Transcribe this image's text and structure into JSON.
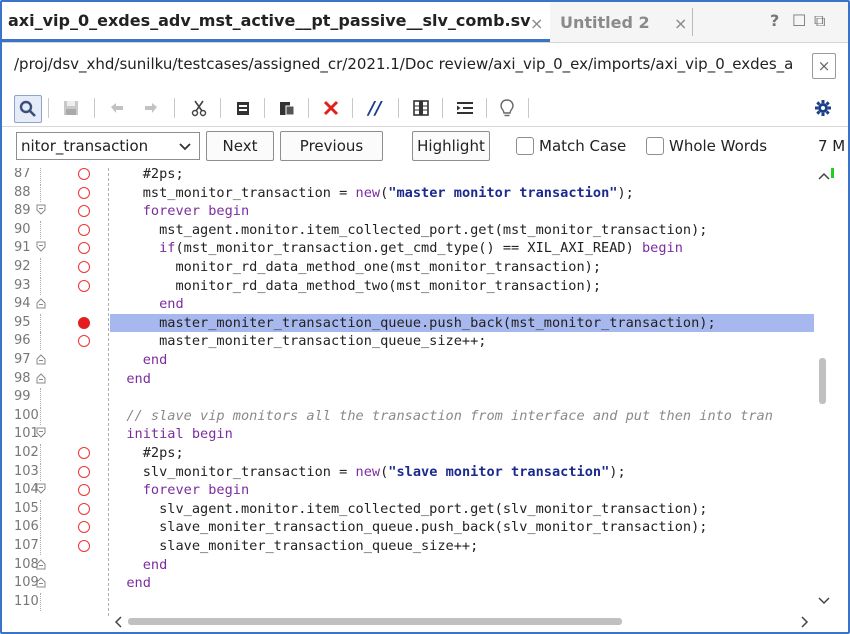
{
  "tabs": [
    {
      "label": "axi_vip_0_exdes_adv_mst_active__pt_passive__slv_comb.sv",
      "active": true
    },
    {
      "label": "Untitled 2",
      "active": false
    }
  ],
  "window_controls": {
    "help": "?",
    "restore": "☐",
    "float": "⧉"
  },
  "path": {
    "text": "/proj/dsv_xhd/sunilku/testcases/assigned_cr/2021.1/Doc review/axi_vip_0_ex/imports/axi_vip_0_exdes_a"
  },
  "toolbar": {
    "icons": [
      "search-icon",
      "save-icon",
      "undo-icon",
      "redo-icon",
      "cut-icon",
      "copy-icon",
      "paste-icon",
      "delete-icon",
      "comment-icon",
      "block-select-icon",
      "indent-icon",
      "lightbulb-icon",
      "settings-icon"
    ]
  },
  "find": {
    "search_value": "nitor_transaction",
    "next_label": "Next",
    "previous_label": "Previous",
    "highlight_label": "Highlight",
    "match_case_label": "Match Case",
    "whole_words_label": "Whole Words",
    "match_count": "7 M"
  },
  "editor": {
    "lines": [
      {
        "num": "87",
        "fold": "",
        "bp": "open",
        "code": "    #2ps;"
      },
      {
        "num": "88",
        "fold": "",
        "bp": "open",
        "code": "    mst_monitor_transaction = new(\"master monitor transaction\");"
      },
      {
        "num": "89",
        "fold": "open",
        "bp": "open",
        "code": "    forever begin"
      },
      {
        "num": "90",
        "fold": "",
        "bp": "open",
        "code": "      mst_agent.monitor.item_collected_port.get(mst_monitor_transaction);"
      },
      {
        "num": "91",
        "fold": "open",
        "bp": "open",
        "code": "      if(mst_monitor_transaction.get_cmd_type() == XIL_AXI_READ) begin"
      },
      {
        "num": "92",
        "fold": "",
        "bp": "open",
        "code": "        monitor_rd_data_method_one(mst_monitor_transaction);"
      },
      {
        "num": "93",
        "fold": "",
        "bp": "open",
        "code": "        monitor_rd_data_method_two(mst_monitor_transaction);"
      },
      {
        "num": "94",
        "fold": "close",
        "bp": "",
        "code": "      end"
      },
      {
        "num": "95",
        "fold": "",
        "bp": "on",
        "code": "      master_moniter_transaction_queue.push_back(mst_monitor_transaction);",
        "highlight": true
      },
      {
        "num": "96",
        "fold": "",
        "bp": "open",
        "code": "      master_moniter_transaction_queue_size++;"
      },
      {
        "num": "97",
        "fold": "close",
        "bp": "",
        "code": "    end"
      },
      {
        "num": "98",
        "fold": "close",
        "bp": "",
        "code": "  end"
      },
      {
        "num": "99",
        "fold": "",
        "bp": "",
        "code": ""
      },
      {
        "num": "100",
        "fold": "",
        "bp": "",
        "code": "  // slave vip monitors all the transaction from interface and put then into tran"
      },
      {
        "num": "101",
        "fold": "open",
        "bp": "",
        "code": "  initial begin"
      },
      {
        "num": "102",
        "fold": "",
        "bp": "open",
        "code": "    #2ps;"
      },
      {
        "num": "103",
        "fold": "",
        "bp": "open",
        "code": "    slv_monitor_transaction = new(\"slave monitor transaction\");"
      },
      {
        "num": "104",
        "fold": "open",
        "bp": "open",
        "code": "    forever begin"
      },
      {
        "num": "105",
        "fold": "",
        "bp": "open",
        "code": "      slv_agent.monitor.item_collected_port.get(slv_monitor_transaction);"
      },
      {
        "num": "106",
        "fold": "",
        "bp": "open",
        "code": "      slave_moniter_transaction_queue.push_back(slv_monitor_transaction);"
      },
      {
        "num": "107",
        "fold": "",
        "bp": "open",
        "code": "      slave_moniter_transaction_queue_size++;"
      },
      {
        "num": "108",
        "fold": "close",
        "bp": "",
        "code": "    end"
      },
      {
        "num": "109",
        "fold": "close",
        "bp": "",
        "code": "  end"
      },
      {
        "num": "110",
        "fold": "",
        "bp": "",
        "code": ""
      }
    ]
  },
  "colors": {
    "accent": "#3a73c8",
    "highlight_line": "#a7b8ef",
    "breakpoint": "#e41e1e",
    "keyword": "#7b2d9e",
    "string": "#1b2a8c"
  }
}
